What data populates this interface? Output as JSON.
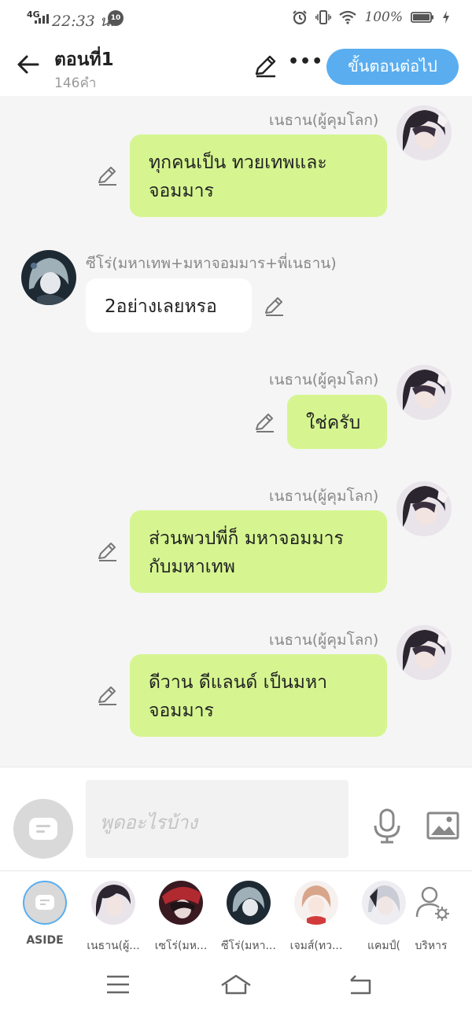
{
  "status_bar": {
    "network": "4G",
    "time": "22:33 น.",
    "notification_count": "10",
    "battery": "100%"
  },
  "header": {
    "title": "ตอนที่1",
    "word_count": "146คำ",
    "next_button": "ขั้นตอนต่อไป"
  },
  "messages": [
    {
      "side": "right",
      "sender": "เนธาน(ผู้คุมโลก)",
      "lines": [
        "ทุกคนเป็น ทวยเทพและ",
        "จอมมาร"
      ]
    },
    {
      "side": "left",
      "sender": "ซีโร่(มหาเทพ+มหาจอมมาร+พี่เนธาน)",
      "lines": [
        "2อย่างเลยหรอ"
      ]
    },
    {
      "side": "right",
      "sender": "เนธาน(ผู้คุมโลก)",
      "lines": [
        "ใช่ครับ"
      ]
    },
    {
      "side": "right",
      "sender": "เนธาน(ผู้คุมโลก)",
      "lines": [
        "ส่วนพวปพี่ก็ มหาจอมมาร",
        "กับมหาเทพ"
      ]
    },
    {
      "side": "right",
      "sender": "เนธาน(ผู้คุมโลก)",
      "lines": [
        "ดีวาน ดีแลนด์ เป็นมหา",
        "จอมมาร"
      ]
    }
  ],
  "input": {
    "placeholder": "พูดอะไรบ้าง"
  },
  "characters": [
    {
      "label": "ASIDE"
    },
    {
      "label": "เนธาน(ผู้..."
    },
    {
      "label": "เซโร่(มห..."
    },
    {
      "label": "ซีโร่(มหา..."
    },
    {
      "label": "เจมส์(ทว..."
    },
    {
      "label": "แคมป์("
    },
    {
      "label": "บริหาร"
    }
  ],
  "colors": {
    "accent": "#5aaef0",
    "bubble_right": "#d6f591",
    "bubble_left": "#ffffff",
    "chat_bg": "#f5f5f5"
  },
  "icons": [
    "back-arrow-icon",
    "pencil-icon",
    "more-icon",
    "mic-icon",
    "image-icon",
    "manage-user-icon",
    "menu-icon",
    "home-icon",
    "back-nav-icon"
  ]
}
